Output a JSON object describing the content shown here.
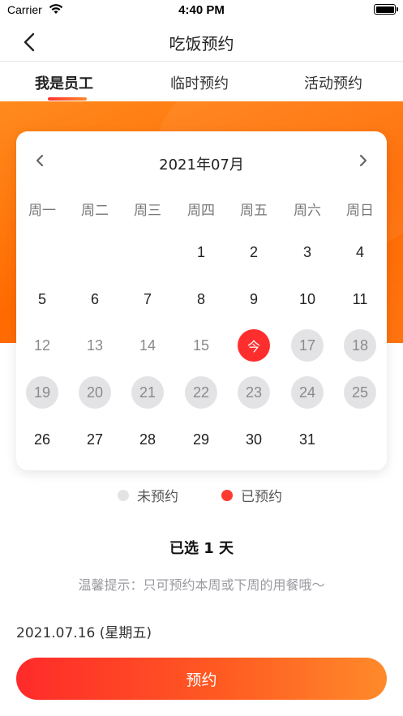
{
  "status_bar": {
    "carrier": "Carrier",
    "time": "4:40 PM"
  },
  "nav": {
    "title": "吃饭预约"
  },
  "tabs": [
    {
      "label": "我是员工",
      "active": true
    },
    {
      "label": "临时预约",
      "active": false
    },
    {
      "label": "活动预约",
      "active": false
    }
  ],
  "calendar": {
    "month_label": "2021年07月",
    "weekdays": [
      "周一",
      "周二",
      "周三",
      "周四",
      "周五",
      "周六",
      "周日"
    ],
    "weeks": [
      [
        null,
        null,
        null,
        {
          "label": "1",
          "state": "normal"
        },
        {
          "label": "2",
          "state": "normal"
        },
        {
          "label": "3",
          "state": "normal"
        },
        {
          "label": "4",
          "state": "normal"
        }
      ],
      [
        {
          "label": "5",
          "state": "normal"
        },
        {
          "label": "6",
          "state": "normal"
        },
        {
          "label": "7",
          "state": "normal"
        },
        {
          "label": "8",
          "state": "normal"
        },
        {
          "label": "9",
          "state": "normal"
        },
        {
          "label": "10",
          "state": "normal"
        },
        {
          "label": "11",
          "state": "normal"
        }
      ],
      [
        {
          "label": "12",
          "state": "past"
        },
        {
          "label": "13",
          "state": "past"
        },
        {
          "label": "14",
          "state": "past"
        },
        {
          "label": "15",
          "state": "past"
        },
        {
          "label": "今",
          "state": "today"
        },
        {
          "label": "17",
          "state": "available"
        },
        {
          "label": "18",
          "state": "available"
        }
      ],
      [
        {
          "label": "19",
          "state": "available"
        },
        {
          "label": "20",
          "state": "available"
        },
        {
          "label": "21",
          "state": "available"
        },
        {
          "label": "22",
          "state": "available"
        },
        {
          "label": "23",
          "state": "available"
        },
        {
          "label": "24",
          "state": "available"
        },
        {
          "label": "25",
          "state": "available"
        }
      ],
      [
        {
          "label": "26",
          "state": "normal"
        },
        {
          "label": "27",
          "state": "normal"
        },
        {
          "label": "28",
          "state": "normal"
        },
        {
          "label": "29",
          "state": "normal"
        },
        {
          "label": "30",
          "state": "normal"
        },
        {
          "label": "31",
          "state": "normal"
        },
        null
      ]
    ]
  },
  "legend": [
    {
      "label": "未预约",
      "color": "#e3e3e6"
    },
    {
      "label": "已预约",
      "color": "#ff3b30"
    }
  ],
  "summary": {
    "prefix": "已选",
    "count": "1",
    "suffix": "天"
  },
  "tip": "温馨提示：只可预约本周或下周的用餐哦～",
  "selected_date": "2021.07.16 (星期五)",
  "book_button": "预约",
  "colors": {
    "accent": "#ff2e2e",
    "orange": "#ff6a00"
  }
}
